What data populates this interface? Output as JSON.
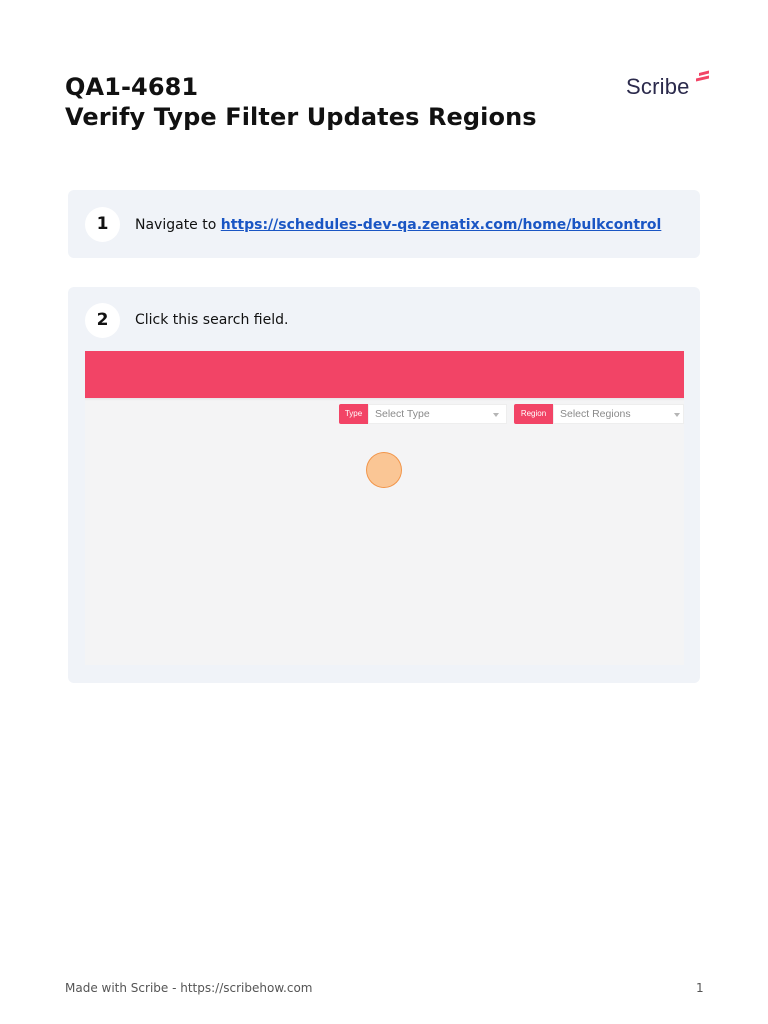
{
  "document": {
    "title_line1": "QA1-4681",
    "title_line2": "Verify Type Filter Updates Regions"
  },
  "logo": {
    "text": "Scribe",
    "accent_color": "#f24466",
    "text_color": "#2b2a4c"
  },
  "steps": [
    {
      "number": "1",
      "text": "Navigate to ",
      "link": "https://schedules-dev-qa.zenatix.com/home/bulkcontrol"
    },
    {
      "number": "2",
      "text": "Click this search field.",
      "screenshot": {
        "header_color": "#f24466",
        "type_filter": {
          "tag": "Type",
          "placeholder": "Select Type"
        },
        "region_filter": {
          "tag": "Region",
          "placeholder": "Select Regions"
        }
      }
    }
  ],
  "footer": {
    "credit": "Made with Scribe - https://scribehow.com",
    "page": "1"
  }
}
